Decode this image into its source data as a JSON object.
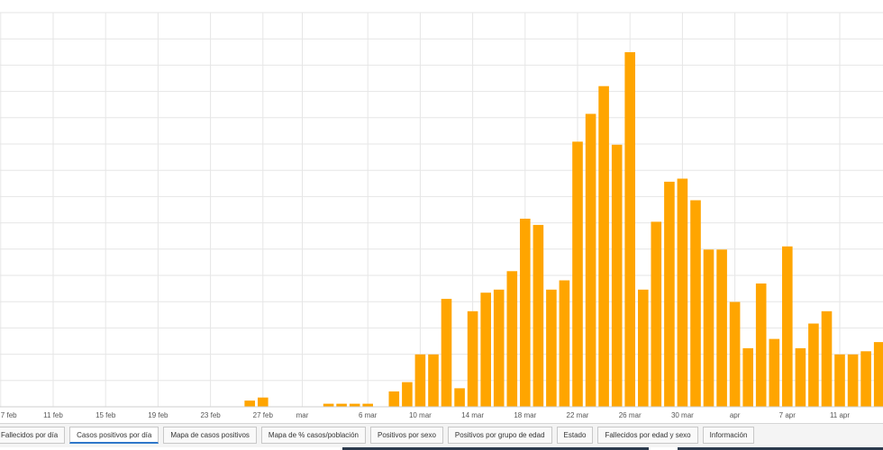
{
  "chart_data": {
    "type": "bar",
    "x_tick_labels": [
      "7 feb",
      "11 feb",
      "15 feb",
      "19 feb",
      "23 feb",
      "27 feb",
      "mar",
      "6 mar",
      "10 mar",
      "14 mar",
      "18 mar",
      "22 mar",
      "26 mar",
      "30 mar",
      "apr",
      "7 apr",
      "11 apr"
    ],
    "x_tick_day_index": [
      0,
      4,
      8,
      12,
      16,
      20,
      23,
      28,
      32,
      36,
      40,
      44,
      48,
      52,
      56,
      60,
      64
    ],
    "first_day_index": 0,
    "values": [
      0,
      0,
      0,
      0,
      0,
      0,
      0,
      0,
      0,
      0,
      0,
      0,
      0,
      0,
      0,
      0,
      0,
      0,
      0,
      2,
      3,
      0,
      0,
      0,
      0,
      1,
      1,
      1,
      1,
      0,
      5,
      8,
      17,
      17,
      35,
      6,
      31,
      37,
      38,
      44,
      61,
      59,
      38,
      41,
      86,
      95,
      104,
      85,
      115,
      38,
      60,
      73,
      74,
      67,
      51,
      51,
      34,
      19,
      40,
      22,
      52,
      19,
      27,
      31,
      17,
      17,
      18,
      21,
      25
    ],
    "ylim": [
      0,
      120
    ],
    "grid": true,
    "bar_color": "#ffa500",
    "grid_color": "#e6e6e6"
  },
  "tabs": [
    {
      "label": "Fallecidos por día",
      "active": false
    },
    {
      "label": "Casos positivos por día",
      "active": true
    },
    {
      "label": "Mapa de casos positivos",
      "active": false
    },
    {
      "label": "Mapa de % casos/población",
      "active": false
    },
    {
      "label": "Positivos por sexo",
      "active": false
    },
    {
      "label": "Positivos por grupo de edad",
      "active": false
    },
    {
      "label": "Estado",
      "active": false
    },
    {
      "label": "Fallecidos por edad y sexo",
      "active": false
    },
    {
      "label": "Información",
      "active": false
    }
  ]
}
